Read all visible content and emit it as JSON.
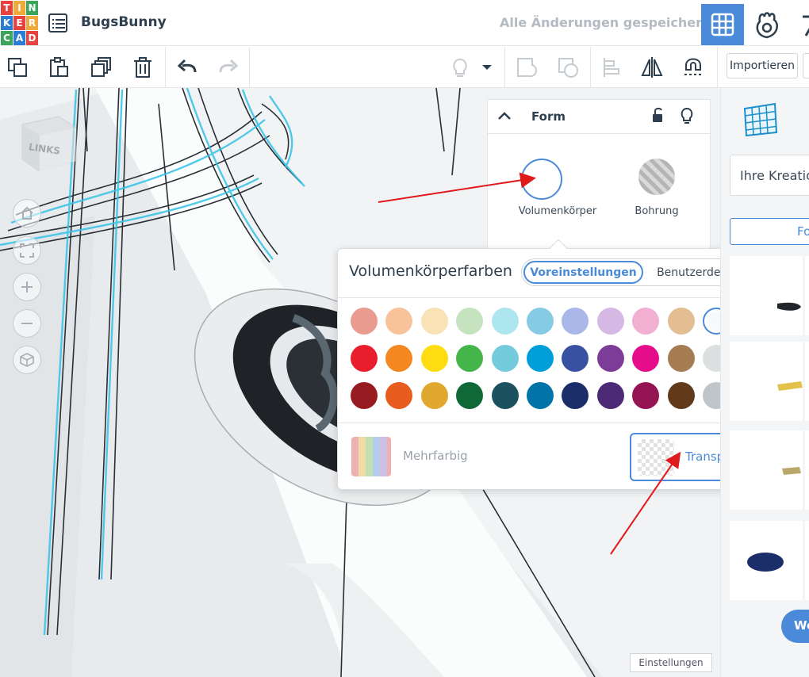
{
  "app": {
    "logo_letters": [
      "T",
      "I",
      "N",
      "K",
      "E",
      "R",
      "C",
      "A",
      "D"
    ],
    "design_title": "BugsBunny",
    "save_status": "Alle Änderungen gespeichert",
    "view_buttons": [
      "3d-view-icon",
      "blocks-view-icon",
      "bricks-view-icon"
    ]
  },
  "toolbar": {
    "icons": [
      "copy-icon",
      "paste-icon",
      "duplicate-icon",
      "delete-icon",
      "undo-icon",
      "redo-icon",
      "lightbulb-icon",
      "group-icon",
      "ungroup-icon",
      "align-icon",
      "mirror-icon",
      "magnet-icon"
    ],
    "import_label": "Importieren"
  },
  "viewcube": {
    "face_label": "LINKS"
  },
  "workplane": {
    "settings_label": "Einstellungen"
  },
  "inspector": {
    "title": "Form",
    "solid_label": "Volumenkörper",
    "hole_label": "Bohrung"
  },
  "color_picker": {
    "title": "Volumenkörperfarben",
    "tab_presets": "Voreinstellungen",
    "tab_custom": "Benutzerdefiniert",
    "selected_index": 10,
    "colors": [
      "#e89b8e",
      "#f8c39a",
      "#f9e3b6",
      "#c6e3c0",
      "#ade6ef",
      "#86cbe4",
      "#a9b8e9",
      "#d5b9e4",
      "#f1afd1",
      "#e2be92",
      "#f7f9fa",
      "#a3a7aa",
      "#e91e2d",
      "#f48720",
      "#ffdc0f",
      "#45b549",
      "#74cbdb",
      "#009fda",
      "#3852a1",
      "#7d3c98",
      "#e60d8b",
      "#a67c52",
      "#dcdfe0",
      "#626a70",
      "#981b21",
      "#e85c20",
      "#e0a82e",
      "#0f6937",
      "#1c5260",
      "#0074a8",
      "#1b2e69",
      "#4c2a76",
      "#951453",
      "#603a1a",
      "#c0c5c9",
      "#2b2e31"
    ],
    "multicolor_label": "Mehrfarbig",
    "transparent_label": "Transparent"
  },
  "right_panel": {
    "library_select": "Ihre Kreationen",
    "search_label": "Fo",
    "cta_label": "We"
  }
}
